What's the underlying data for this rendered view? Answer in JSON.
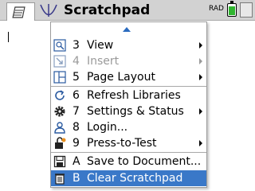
{
  "header": {
    "title": "Scratchpad",
    "mode": "RAD",
    "battery_level": 0.85
  },
  "menu": {
    "items": [
      {
        "number": "3",
        "label": "View",
        "icon": "view-icon",
        "submenu": true,
        "disabled": false,
        "selected": false
      },
      {
        "number": "4",
        "label": "Insert",
        "icon": "insert-icon",
        "submenu": true,
        "disabled": true,
        "selected": false
      },
      {
        "number": "5",
        "label": "Page Layout",
        "icon": "page-layout-icon",
        "submenu": true,
        "disabled": false,
        "selected": false
      },
      {
        "number": "6",
        "label": "Refresh Libraries",
        "icon": "refresh-icon",
        "submenu": false,
        "disabled": false,
        "selected": false
      },
      {
        "number": "7",
        "label": "Settings & Status",
        "icon": "gear-icon",
        "submenu": true,
        "disabled": false,
        "selected": false
      },
      {
        "number": "8",
        "label": "Login...",
        "icon": "user-icon",
        "submenu": false,
        "disabled": false,
        "selected": false
      },
      {
        "number": "9",
        "label": "Press-to-Test",
        "icon": "lock-icon",
        "submenu": true,
        "disabled": false,
        "selected": false
      },
      {
        "number": "A",
        "label": "Save to Document...",
        "icon": "save-icon",
        "submenu": false,
        "disabled": false,
        "selected": false
      },
      {
        "number": "B",
        "label": "Clear Scratchpad",
        "icon": "trash-icon",
        "submenu": false,
        "disabled": false,
        "selected": true
      }
    ]
  },
  "colors": {
    "accent": "#3a78c8",
    "titlebar": "#d2d2d2",
    "battery": "#2fb52f"
  }
}
